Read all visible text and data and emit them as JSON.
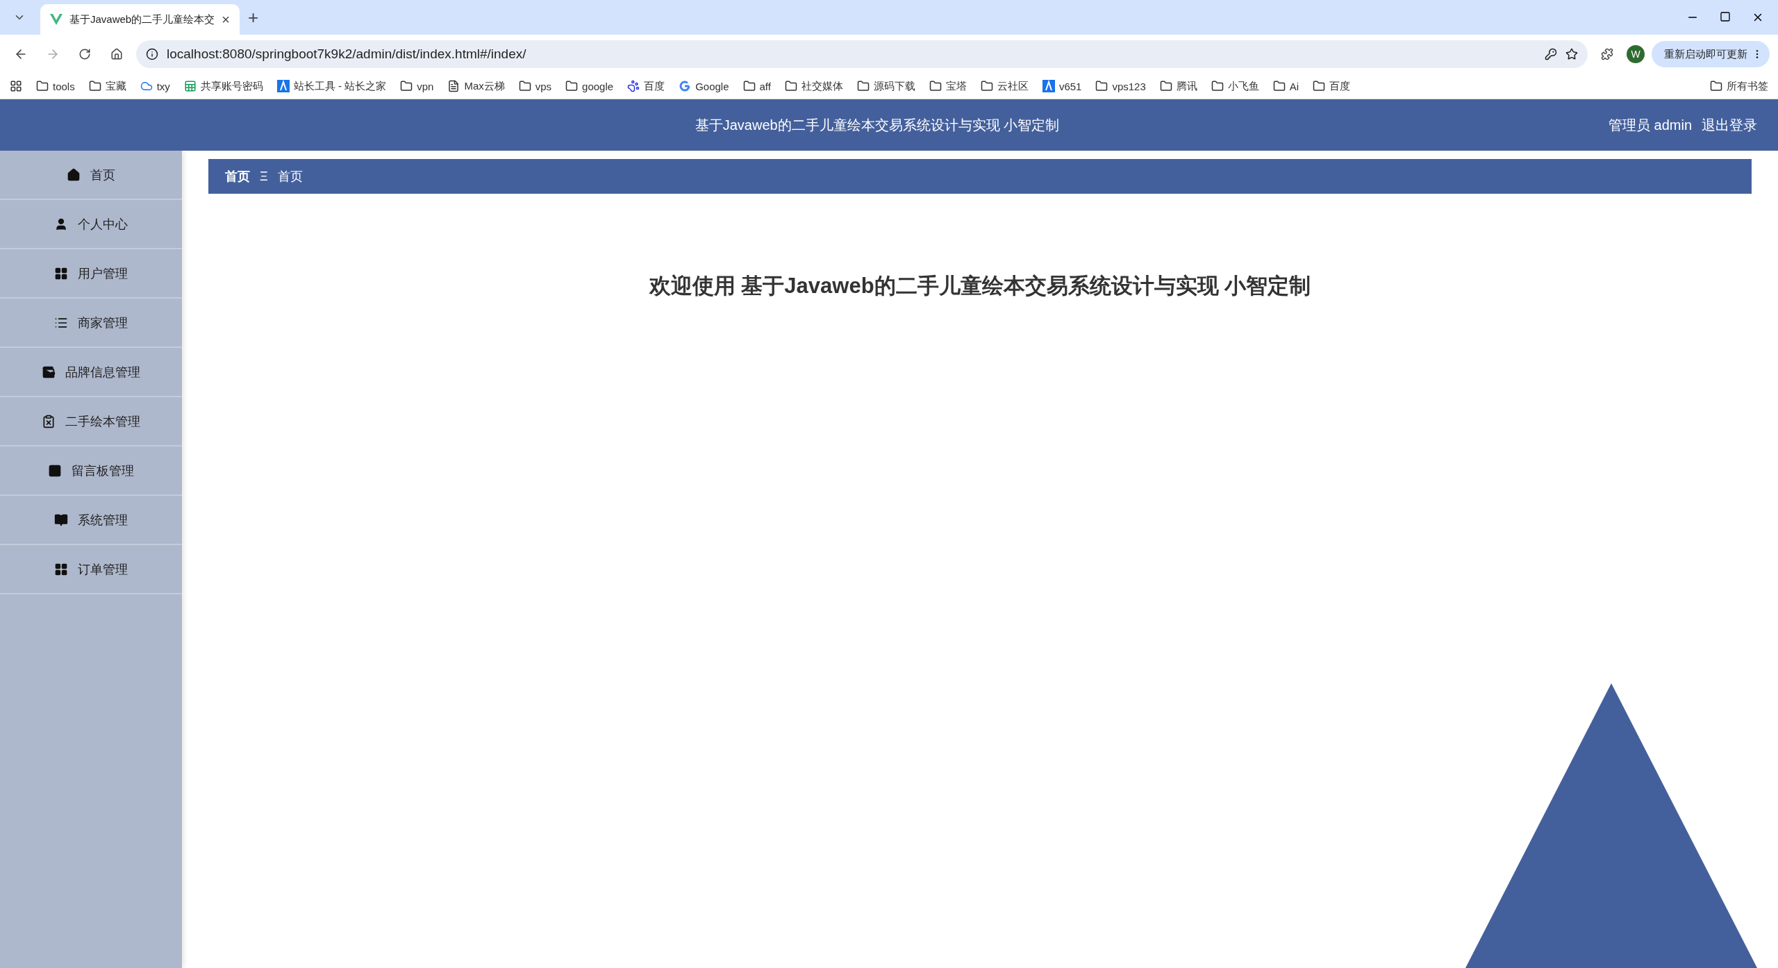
{
  "browser": {
    "tab": {
      "title": "基于Javaweb的二手儿童绘本交",
      "close": "×"
    },
    "new_tab": "+",
    "url": "localhost:8080/springboot7k9k2/admin/dist/index.html#/index/",
    "profile": "W",
    "update_button": "重新启动即可更新",
    "bookmarks": [
      {
        "label": "tools",
        "kind": "folder"
      },
      {
        "label": "宝藏",
        "kind": "folder"
      },
      {
        "label": "txy",
        "kind": "cloud"
      },
      {
        "label": "共享账号密码",
        "kind": "sheet"
      },
      {
        "label": "站长工具 - 站长之家",
        "kind": "site"
      },
      {
        "label": "vpn",
        "kind": "folder"
      },
      {
        "label": "Max云梯",
        "kind": "page"
      },
      {
        "label": "vps",
        "kind": "folder"
      },
      {
        "label": "google",
        "kind": "folder"
      },
      {
        "label": "百度",
        "kind": "paw"
      },
      {
        "label": "Google",
        "kind": "google"
      },
      {
        "label": "aff",
        "kind": "folder"
      },
      {
        "label": "社交媒体",
        "kind": "folder"
      },
      {
        "label": "源码下载",
        "kind": "folder"
      },
      {
        "label": "宝塔",
        "kind": "folder"
      },
      {
        "label": "云社区",
        "kind": "folder"
      },
      {
        "label": "v651",
        "kind": "site"
      },
      {
        "label": "vps123",
        "kind": "folder"
      },
      {
        "label": "腾讯",
        "kind": "folder"
      },
      {
        "label": "小飞鱼",
        "kind": "folder"
      },
      {
        "label": "Ai",
        "kind": "folder"
      },
      {
        "label": "百度",
        "kind": "folder"
      }
    ],
    "all_bookmarks": "所有书签"
  },
  "header": {
    "title": "基于Javaweb的二手儿童绘本交易系统设计与实现 小智定制",
    "user": "管理员 admin",
    "logout": "退出登录"
  },
  "sidebar": {
    "items": [
      {
        "label": "首页"
      },
      {
        "label": "个人中心"
      },
      {
        "label": "用户管理"
      },
      {
        "label": "商家管理"
      },
      {
        "label": "品牌信息管理"
      },
      {
        "label": "二手绘本管理"
      },
      {
        "label": "留言板管理"
      },
      {
        "label": "系统管理"
      },
      {
        "label": "订单管理"
      }
    ]
  },
  "breadcrumb": {
    "items": [
      "首页",
      "首页"
    ],
    "separator": "Ξ"
  },
  "welcome": "欢迎使用 基于Javaweb的二手儿童绘本交易系统设计与实现 小智定制"
}
